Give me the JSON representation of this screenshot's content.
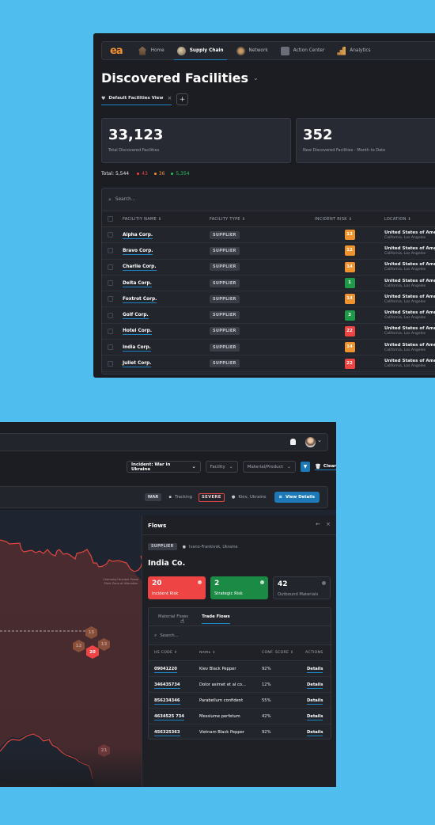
{
  "top": {
    "logo": "ea",
    "nav": [
      {
        "label": "Home",
        "icon": "home-icon",
        "active": false
      },
      {
        "label": "Supply Chain",
        "icon": "supply-chain-icon",
        "active": true
      },
      {
        "label": "Network",
        "icon": "network-icon",
        "active": false
      },
      {
        "label": "Action Center",
        "icon": "action-center-icon",
        "active": false
      },
      {
        "label": "Analytics",
        "icon": "analytics-icon",
        "active": false
      }
    ],
    "title": "Discovered Facilities",
    "title_chevron": "⌄",
    "view_tab": {
      "icon": "♥",
      "label": "Default Facilities View",
      "close": "×"
    },
    "add_view": "+",
    "kpis": [
      {
        "value": "33,123",
        "label": "Total Discovered Facilities"
      },
      {
        "value": "352",
        "label": "New Discovered Facilities - Month to Date"
      }
    ],
    "totals": {
      "label": "Total: 5,544",
      "counts": [
        {
          "value": "43",
          "color": "#ef4444"
        },
        {
          "value": "36",
          "color": "#f0922d"
        },
        {
          "value": "5,354",
          "color": "#22c55e"
        }
      ]
    },
    "search_placeholder": "Search...",
    "columns": [
      "FACILITIY NAME ⇕",
      "FACILITY TYPE ⇕",
      "INCIDENT RISK ⇕",
      "LOCATION ⇕"
    ],
    "rows": [
      {
        "name": "Alpha Corp.",
        "type": "SUPPLIER",
        "risk": "13",
        "risk_color": "#f0922d",
        "country": "United States of America",
        "region": "California, Los Angeles"
      },
      {
        "name": "Bravo Corp.",
        "type": "SUPPLIER",
        "risk": "12",
        "risk_color": "#f0922d",
        "country": "United States of America",
        "region": "California, Los Angeles"
      },
      {
        "name": "Charlie Corp.",
        "type": "SUPPLIER",
        "risk": "14",
        "risk_color": "#f0922d",
        "country": "United States of America",
        "region": "California, Los Angeles"
      },
      {
        "name": "Delta Corp.",
        "type": "SUPPLIER",
        "risk": "1",
        "risk_color": "#1f9a48",
        "country": "United States of America",
        "region": "California, Los Angeles"
      },
      {
        "name": "Foxtrot Corp.",
        "type": "SUPPLIER",
        "risk": "14",
        "risk_color": "#f0922d",
        "country": "United States of America",
        "region": "California, Los Angeles"
      },
      {
        "name": "Golf Corp.",
        "type": "SUPPLIER",
        "risk": "3",
        "risk_color": "#1f9a48",
        "country": "United States of America",
        "region": "California, Los Angeles"
      },
      {
        "name": "Hotel Corp.",
        "type": "SUPPLIER",
        "risk": "22",
        "risk_color": "#ef4444",
        "country": "United States of America",
        "region": "California, Los Angeles"
      },
      {
        "name": "India Corp.",
        "type": "SUPPLIER",
        "risk": "14",
        "risk_color": "#f0922d",
        "country": "United States of America",
        "region": "California, Los Angeles"
      },
      {
        "name": "Juliet Corp.",
        "type": "SUPPLIER",
        "risk": "22",
        "risk_color": "#ef4444",
        "country": "United States of America",
        "region": "California, Los Angeles"
      }
    ]
  },
  "bottom": {
    "filters": {
      "incident": "Incident: War in Ukraine",
      "facility": "Facility",
      "material": "Material/Product",
      "clear": "Clear",
      "chev": "⌄"
    },
    "incident_bar": {
      "tag": "WAR",
      "tracking": "Tracking",
      "severity": "SEVERE",
      "location": "Kiev, Ukraine",
      "view_details": "View Details"
    },
    "map": {
      "label": "Chernobyl Nuclear Power Plant Zone of Alienation",
      "clusters": [
        {
          "value": "15",
          "kind": "dim"
        },
        {
          "value": "12",
          "kind": "dim"
        },
        {
          "value": "13",
          "kind": "dim"
        },
        {
          "value": "20",
          "kind": "hot"
        },
        {
          "value": "21",
          "kind": "faint"
        }
      ]
    },
    "flows": {
      "title": "Flows",
      "back": "←",
      "close": "×",
      "supplier_tag": "SUPPLIER",
      "location": "Ivano-Frankivsk, Ukraine",
      "name": "India Co.",
      "metrics": [
        {
          "value": "20",
          "label": "Incident Risk"
        },
        {
          "value": "2",
          "label": "Strategic Risk"
        },
        {
          "value": "42",
          "label": "Outbound Materials"
        }
      ],
      "tabs": [
        {
          "label": "Material Flows",
          "active": false
        },
        {
          "label": "Trade Flows",
          "active": true
        }
      ],
      "search_placeholder": "Search...",
      "columns": [
        "HS CODE ⇕",
        "NAME ⇕",
        "CONF. SCORE ⇕",
        "ACTIONS"
      ],
      "rows": [
        {
          "hs": "09041220",
          "name": "Kiev Black Pepper",
          "score": "92%",
          "action": "Details"
        },
        {
          "hs": "346435734",
          "name": "Dolor asimet et al co...",
          "score": "12%",
          "action": "Details"
        },
        {
          "hs": "856234346",
          "name": "Parabellum confident",
          "score": "55%",
          "action": "Details"
        },
        {
          "hs": "4634525 734",
          "name": "Messiume perfetum",
          "score": "42%",
          "action": "Details"
        },
        {
          "hs": "456325363",
          "name": "Vietnam Black Pepper",
          "score": "92%",
          "action": "Details"
        }
      ]
    }
  }
}
